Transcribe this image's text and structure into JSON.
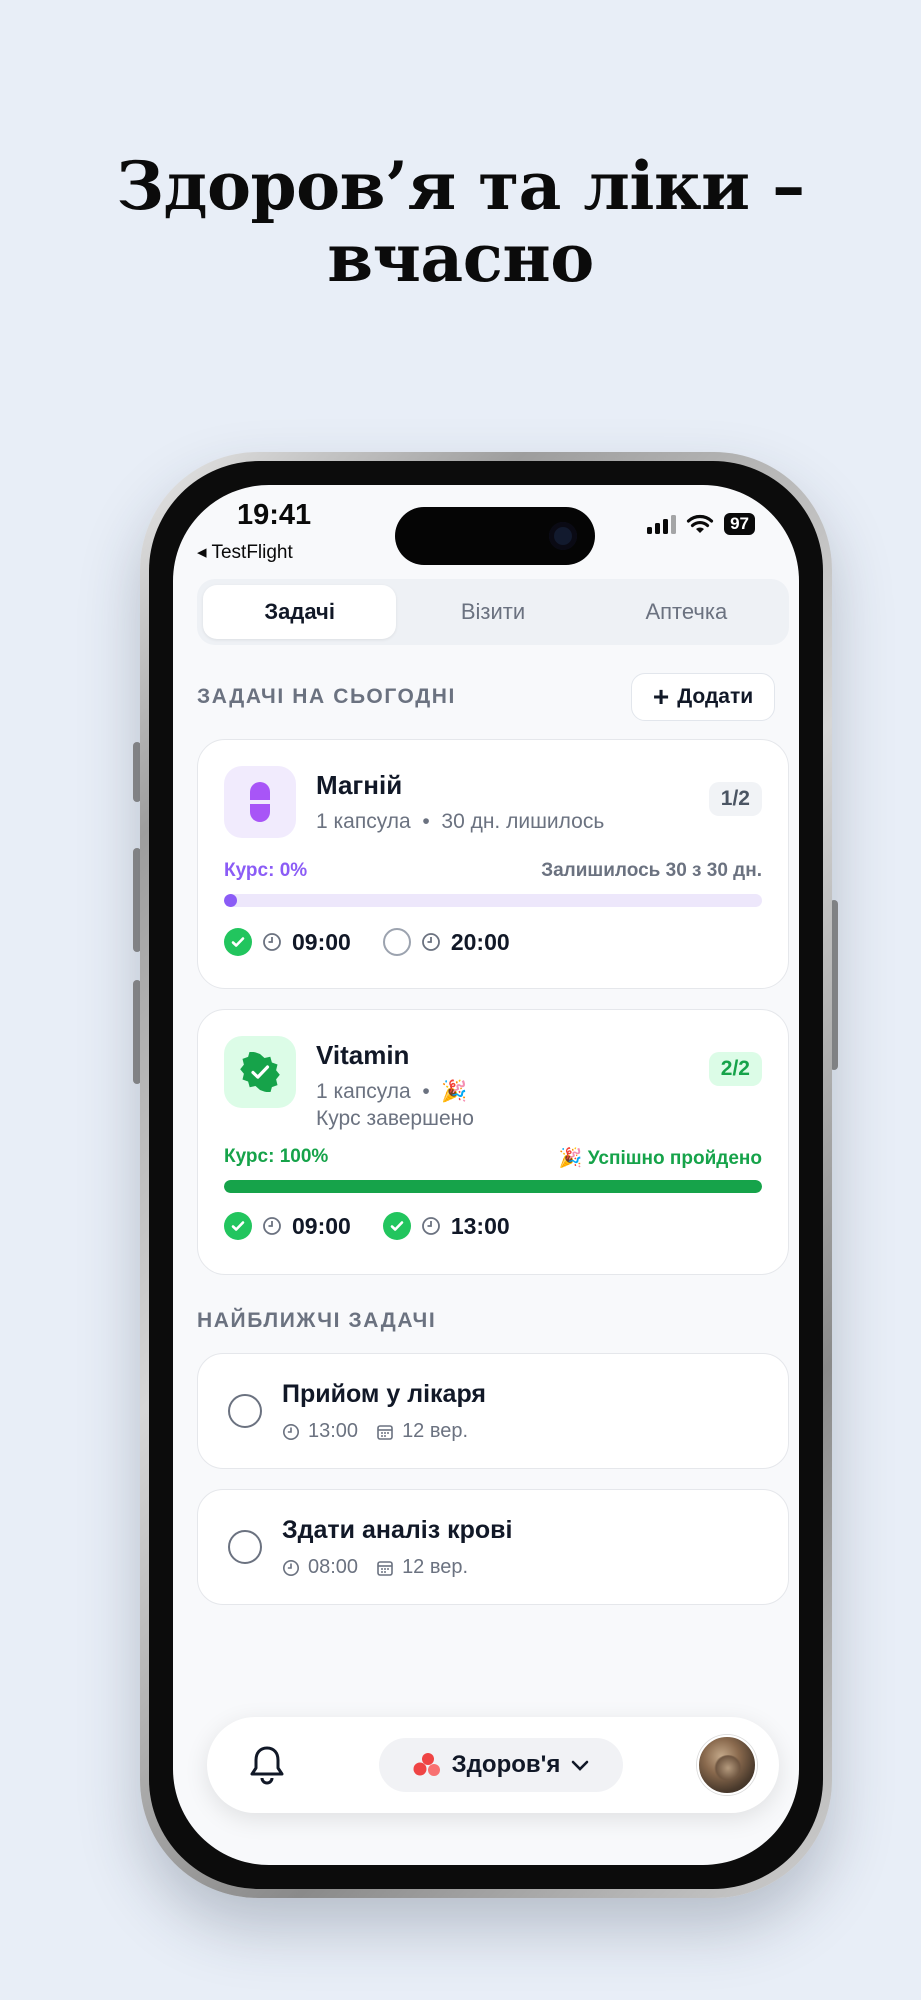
{
  "headline": {
    "line1": "Здоров’я та ліки –",
    "line2": "вчасно"
  },
  "status_bar": {
    "time": "19:41",
    "back_label": "◂ TestFlight",
    "battery": "97"
  },
  "tabs": [
    {
      "label": "Задачі",
      "active": true
    },
    {
      "label": "Візити",
      "active": false
    },
    {
      "label": "Аптечка",
      "active": false
    }
  ],
  "today": {
    "section_title": "ЗАДАЧІ НА СЬОГОДНІ",
    "add_label": "Додати",
    "meds": [
      {
        "name": "Магній",
        "dose": "1 капсула",
        "separator": "•",
        "left": "30 дн. лишилось",
        "badge": "1/2",
        "course_label": "Курс: 0%",
        "course_right": "Залишилось 30 з 30 дн.",
        "progress": 0,
        "icon": "pill-icon",
        "accent": "#8b5cf6",
        "doses": [
          {
            "time": "09:00",
            "done": true
          },
          {
            "time": "20:00",
            "done": false
          }
        ]
      },
      {
        "name": "Vitamin",
        "dose": "1 капсула",
        "separator": "•",
        "emoji": "🎉",
        "status": "Курс завершено",
        "badge": "2/2",
        "course_label": "Курс: 100%",
        "course_right": "🎉 Успішно пройдено",
        "progress": 1,
        "icon": "verified-badge-icon",
        "accent": "#16a34a",
        "doses": [
          {
            "time": "09:00",
            "done": true
          },
          {
            "time": "13:00",
            "done": true
          }
        ]
      }
    ]
  },
  "upcoming": {
    "section_title": "НАЙБЛИЖЧІ ЗАДАЧІ",
    "tasks": [
      {
        "title": "Прийом у лікаря",
        "time": "13:00",
        "date": "12 вер."
      },
      {
        "title": "Здати аналіз крові",
        "time": "08:00",
        "date": "12 вер."
      }
    ]
  },
  "tab_bar": {
    "profile_label": "Здоров'я",
    "icons": [
      "bell-icon",
      "health-drops-icon",
      "chevron-down-icon"
    ]
  },
  "colors": {
    "background": "#e8eef7",
    "purple": "#8b5cf6",
    "green": "#16a34a",
    "red": "#ef4444"
  }
}
